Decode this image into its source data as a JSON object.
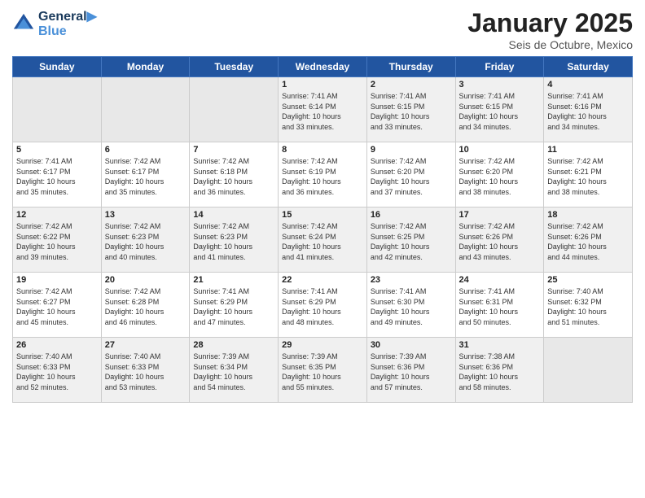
{
  "header": {
    "logo_line1": "General",
    "logo_line2": "Blue",
    "title": "January 2025",
    "subtitle": "Seis de Octubre, Mexico"
  },
  "days_of_week": [
    "Sunday",
    "Monday",
    "Tuesday",
    "Wednesday",
    "Thursday",
    "Friday",
    "Saturday"
  ],
  "weeks": [
    [
      {
        "day": "",
        "info": ""
      },
      {
        "day": "",
        "info": ""
      },
      {
        "day": "",
        "info": ""
      },
      {
        "day": "1",
        "info": "Sunrise: 7:41 AM\nSunset: 6:14 PM\nDaylight: 10 hours\nand 33 minutes."
      },
      {
        "day": "2",
        "info": "Sunrise: 7:41 AM\nSunset: 6:15 PM\nDaylight: 10 hours\nand 33 minutes."
      },
      {
        "day": "3",
        "info": "Sunrise: 7:41 AM\nSunset: 6:15 PM\nDaylight: 10 hours\nand 34 minutes."
      },
      {
        "day": "4",
        "info": "Sunrise: 7:41 AM\nSunset: 6:16 PM\nDaylight: 10 hours\nand 34 minutes."
      }
    ],
    [
      {
        "day": "5",
        "info": "Sunrise: 7:41 AM\nSunset: 6:17 PM\nDaylight: 10 hours\nand 35 minutes."
      },
      {
        "day": "6",
        "info": "Sunrise: 7:42 AM\nSunset: 6:17 PM\nDaylight: 10 hours\nand 35 minutes."
      },
      {
        "day": "7",
        "info": "Sunrise: 7:42 AM\nSunset: 6:18 PM\nDaylight: 10 hours\nand 36 minutes."
      },
      {
        "day": "8",
        "info": "Sunrise: 7:42 AM\nSunset: 6:19 PM\nDaylight: 10 hours\nand 36 minutes."
      },
      {
        "day": "9",
        "info": "Sunrise: 7:42 AM\nSunset: 6:20 PM\nDaylight: 10 hours\nand 37 minutes."
      },
      {
        "day": "10",
        "info": "Sunrise: 7:42 AM\nSunset: 6:20 PM\nDaylight: 10 hours\nand 38 minutes."
      },
      {
        "day": "11",
        "info": "Sunrise: 7:42 AM\nSunset: 6:21 PM\nDaylight: 10 hours\nand 38 minutes."
      }
    ],
    [
      {
        "day": "12",
        "info": "Sunrise: 7:42 AM\nSunset: 6:22 PM\nDaylight: 10 hours\nand 39 minutes."
      },
      {
        "day": "13",
        "info": "Sunrise: 7:42 AM\nSunset: 6:23 PM\nDaylight: 10 hours\nand 40 minutes."
      },
      {
        "day": "14",
        "info": "Sunrise: 7:42 AM\nSunset: 6:23 PM\nDaylight: 10 hours\nand 41 minutes."
      },
      {
        "day": "15",
        "info": "Sunrise: 7:42 AM\nSunset: 6:24 PM\nDaylight: 10 hours\nand 41 minutes."
      },
      {
        "day": "16",
        "info": "Sunrise: 7:42 AM\nSunset: 6:25 PM\nDaylight: 10 hours\nand 42 minutes."
      },
      {
        "day": "17",
        "info": "Sunrise: 7:42 AM\nSunset: 6:26 PM\nDaylight: 10 hours\nand 43 minutes."
      },
      {
        "day": "18",
        "info": "Sunrise: 7:42 AM\nSunset: 6:26 PM\nDaylight: 10 hours\nand 44 minutes."
      }
    ],
    [
      {
        "day": "19",
        "info": "Sunrise: 7:42 AM\nSunset: 6:27 PM\nDaylight: 10 hours\nand 45 minutes."
      },
      {
        "day": "20",
        "info": "Sunrise: 7:42 AM\nSunset: 6:28 PM\nDaylight: 10 hours\nand 46 minutes."
      },
      {
        "day": "21",
        "info": "Sunrise: 7:41 AM\nSunset: 6:29 PM\nDaylight: 10 hours\nand 47 minutes."
      },
      {
        "day": "22",
        "info": "Sunrise: 7:41 AM\nSunset: 6:29 PM\nDaylight: 10 hours\nand 48 minutes."
      },
      {
        "day": "23",
        "info": "Sunrise: 7:41 AM\nSunset: 6:30 PM\nDaylight: 10 hours\nand 49 minutes."
      },
      {
        "day": "24",
        "info": "Sunrise: 7:41 AM\nSunset: 6:31 PM\nDaylight: 10 hours\nand 50 minutes."
      },
      {
        "day": "25",
        "info": "Sunrise: 7:40 AM\nSunset: 6:32 PM\nDaylight: 10 hours\nand 51 minutes."
      }
    ],
    [
      {
        "day": "26",
        "info": "Sunrise: 7:40 AM\nSunset: 6:33 PM\nDaylight: 10 hours\nand 52 minutes."
      },
      {
        "day": "27",
        "info": "Sunrise: 7:40 AM\nSunset: 6:33 PM\nDaylight: 10 hours\nand 53 minutes."
      },
      {
        "day": "28",
        "info": "Sunrise: 7:39 AM\nSunset: 6:34 PM\nDaylight: 10 hours\nand 54 minutes."
      },
      {
        "day": "29",
        "info": "Sunrise: 7:39 AM\nSunset: 6:35 PM\nDaylight: 10 hours\nand 55 minutes."
      },
      {
        "day": "30",
        "info": "Sunrise: 7:39 AM\nSunset: 6:36 PM\nDaylight: 10 hours\nand 57 minutes."
      },
      {
        "day": "31",
        "info": "Sunrise: 7:38 AM\nSunset: 6:36 PM\nDaylight: 10 hours\nand 58 minutes."
      },
      {
        "day": "",
        "info": ""
      }
    ]
  ]
}
